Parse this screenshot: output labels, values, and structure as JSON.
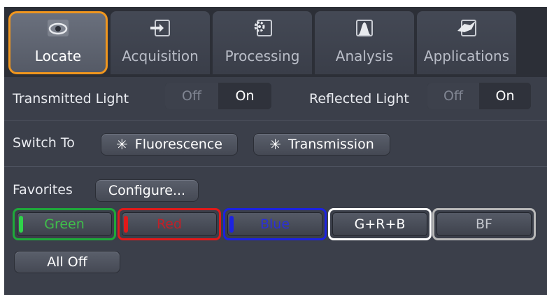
{
  "tabs": [
    {
      "label": "Locate",
      "icon": "eye-icon",
      "active": true
    },
    {
      "label": "Acquisition",
      "icon": "camera-icon",
      "active": false
    },
    {
      "label": "Processing",
      "icon": "gear-icon",
      "active": false
    },
    {
      "label": "Analysis",
      "icon": "histogram-icon",
      "active": false
    },
    {
      "label": "Applications",
      "icon": "applications-icon",
      "active": false
    }
  ],
  "transmitted": {
    "label": "Transmitted Light",
    "off": "Off",
    "on": "On",
    "state": "On"
  },
  "reflected": {
    "label": "Reflected Light",
    "off": "Off",
    "on": "On",
    "state": "On"
  },
  "switch_to": {
    "label": "Switch To",
    "fluorescence": "Fluorescence",
    "transmission": "Transmission",
    "star_icon": "sparkle-icon"
  },
  "favorites": {
    "label": "Favorites",
    "configure": "Configure...",
    "items": [
      {
        "label": "Green",
        "text_color": "#3fbf4a",
        "border_color": "#1fa83a",
        "indicator_color": "#2fd34a"
      },
      {
        "label": "Red",
        "text_color": "#c02028",
        "border_color": "#e01a1a",
        "indicator_color": "#e01a1a"
      },
      {
        "label": "Blue",
        "text_color": "#2a2fd8",
        "border_color": "#1c22e0",
        "indicator_color": "#1c22e0"
      },
      {
        "label": "G+R+B",
        "text_color": "#ffffff",
        "border_color": "#ffffff",
        "indicator_color": ""
      },
      {
        "label": "BF",
        "text_color": "#c4c7ce",
        "border_color": "#b8b8b8",
        "indicator_color": ""
      }
    ],
    "all_off": "All Off"
  },
  "colors": {
    "accent_active_tab": "#f0961e",
    "panel_bg": "#3b3f4a"
  }
}
